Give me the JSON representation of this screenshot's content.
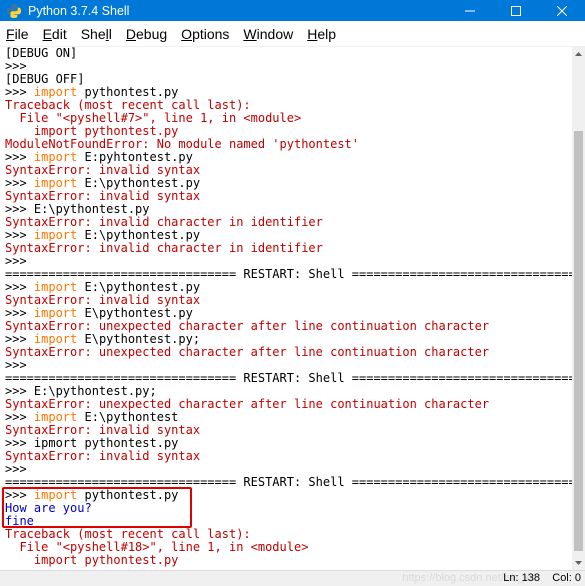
{
  "window": {
    "title": "Python 3.7.4 Shell",
    "minimize_glyph": "—",
    "maximize_glyph": "☐",
    "close_glyph": "✕",
    "colors": {
      "titlebar": "#0078d7",
      "error": "#c00000",
      "keyword": "#ff7700",
      "output": "#0000c0"
    }
  },
  "menu": {
    "file": {
      "key": "F",
      "rest": "ile"
    },
    "edit": {
      "key": "E",
      "rest": "dit"
    },
    "shell": {
      "pre": "She",
      "key": "l",
      "rest": "l"
    },
    "debug": {
      "key": "D",
      "rest": "ebug"
    },
    "options": {
      "key": "O",
      "rest": "ptions"
    },
    "window": {
      "key": "W",
      "rest": "indow"
    },
    "help": {
      "key": "H",
      "rest": "elp"
    }
  },
  "lines": [
    [
      {
        "t": "[DEBUG ON]",
        "c": "default"
      }
    ],
    [
      {
        "t": ">>> ",
        "c": "prompt"
      }
    ],
    [
      {
        "t": "[DEBUG OFF]",
        "c": "default"
      }
    ],
    [
      {
        "t": ">>> ",
        "c": "prompt"
      },
      {
        "t": "import",
        "c": "kw"
      },
      {
        "t": " pythontest.py",
        "c": "default"
      }
    ],
    [
      {
        "t": "Traceback (most recent call last):",
        "c": "red"
      }
    ],
    [
      {
        "t": "  File \"<pyshell#7>\", line 1, in <module>",
        "c": "red"
      }
    ],
    [
      {
        "t": "    import pythontest.py",
        "c": "red"
      }
    ],
    [
      {
        "t": "ModuleNotFoundError: No module named 'pythontest'",
        "c": "red"
      }
    ],
    [
      {
        "t": ">>> ",
        "c": "prompt"
      },
      {
        "t": "import",
        "c": "kw"
      },
      {
        "t": " E:pyhtontest.py",
        "c": "default"
      }
    ],
    [
      {
        "t": "SyntaxError: invalid syntax",
        "c": "red"
      }
    ],
    [
      {
        "t": ">>> ",
        "c": "prompt"
      },
      {
        "t": "import",
        "c": "kw"
      },
      {
        "t": " E:\\pythontest.py",
        "c": "default"
      }
    ],
    [
      {
        "t": "SyntaxError: invalid syntax",
        "c": "red"
      }
    ],
    [
      {
        "t": ">>> ",
        "c": "prompt"
      },
      {
        "t": "E:\\pythontest.py",
        "c": "default"
      }
    ],
    [
      {
        "t": "SyntaxError: invalid character in identifier",
        "c": "red"
      }
    ],
    [
      {
        "t": ">>> ",
        "c": "prompt"
      },
      {
        "t": "import",
        "c": "kw"
      },
      {
        "t": " E:\\pythontest.py",
        "c": "default"
      }
    ],
    [
      {
        "t": "SyntaxError: invalid character in identifier",
        "c": "red"
      }
    ],
    [
      {
        "t": ">>> ",
        "c": "prompt"
      }
    ],
    [
      {
        "t": "================================ RESTART: Shell ================================",
        "c": "default"
      }
    ],
    [
      {
        "t": ">>> ",
        "c": "prompt"
      },
      {
        "t": "import",
        "c": "kw"
      },
      {
        "t": " E:\\pythontest.py",
        "c": "default"
      }
    ],
    [
      {
        "t": "SyntaxError: invalid syntax",
        "c": "red"
      }
    ],
    [
      {
        "t": ">>> ",
        "c": "prompt"
      },
      {
        "t": "import",
        "c": "kw"
      },
      {
        "t": " E\\pythontest.py",
        "c": "default"
      }
    ],
    [
      {
        "t": "SyntaxError: unexpected character after line continuation character",
        "c": "red"
      }
    ],
    [
      {
        "t": ">>> ",
        "c": "prompt"
      },
      {
        "t": "import",
        "c": "kw"
      },
      {
        "t": " E\\pythontest.py;",
        "c": "default"
      }
    ],
    [
      {
        "t": "SyntaxError: unexpected character after line continuation character",
        "c": "red"
      }
    ],
    [
      {
        "t": ">>> ",
        "c": "prompt"
      }
    ],
    [
      {
        "t": "================================ RESTART: Shell ================================",
        "c": "default"
      }
    ],
    [
      {
        "t": ">>> ",
        "c": "prompt"
      },
      {
        "t": "E:\\pythontest.py;",
        "c": "default"
      }
    ],
    [
      {
        "t": "SyntaxError: unexpected character after line continuation character",
        "c": "red"
      }
    ],
    [
      {
        "t": ">>> ",
        "c": "prompt"
      },
      {
        "t": "import",
        "c": "kw"
      },
      {
        "t": " E:\\pythontest",
        "c": "default"
      }
    ],
    [
      {
        "t": "SyntaxError: invalid syntax",
        "c": "red"
      }
    ],
    [
      {
        "t": ">>> ",
        "c": "prompt"
      },
      {
        "t": "ipmort pythontest.py",
        "c": "default"
      }
    ],
    [
      {
        "t": "SyntaxError: invalid syntax",
        "c": "red"
      }
    ],
    [
      {
        "t": ">>> ",
        "c": "prompt"
      }
    ],
    [
      {
        "t": "================================ RESTART: Shell ================================",
        "c": "default"
      }
    ],
    [
      {
        "t": ">>> ",
        "c": "prompt"
      },
      {
        "t": "import",
        "c": "kw"
      },
      {
        "t": " pythontest.py",
        "c": "default"
      }
    ],
    [
      {
        "t": "How are you?",
        "c": "blue"
      }
    ],
    [
      {
        "t": "fine",
        "c": "blue"
      }
    ],
    [
      {
        "t": "Traceback (most recent call last):",
        "c": "red"
      }
    ],
    [
      {
        "t": "  File \"<pyshell#18>\", line 1, in <module>",
        "c": "red"
      }
    ],
    [
      {
        "t": "    import pythontest.py",
        "c": "red"
      }
    ]
  ],
  "status": {
    "ln": "Ln: 138",
    "col": "Col: 0"
  },
  "watermark": "https://blog.csdn.net/lsh_xx"
}
